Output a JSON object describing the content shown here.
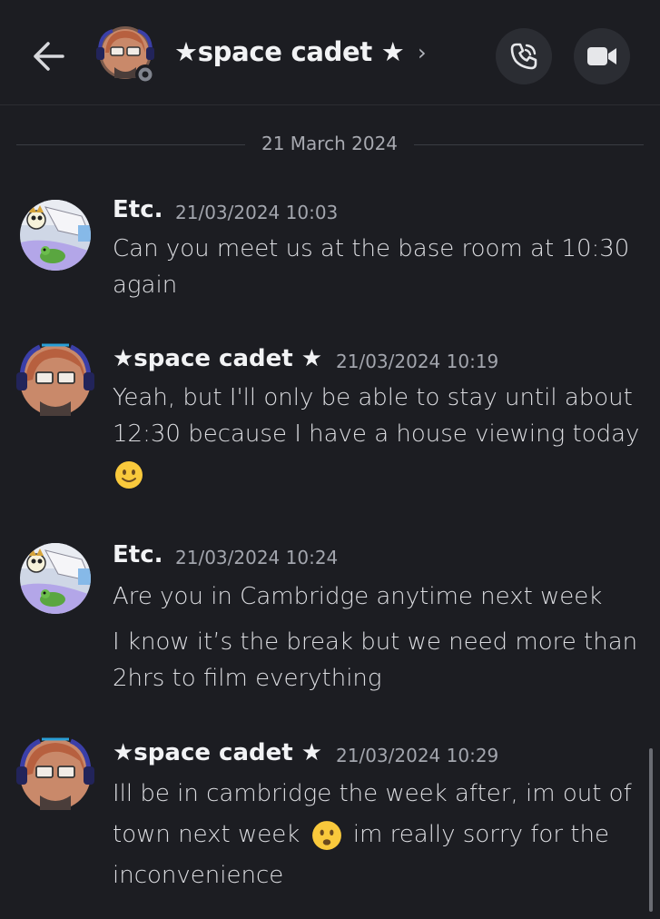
{
  "header": {
    "title": "★space cadet ★",
    "chevron": "›",
    "icons": {
      "back": "arrow-left-icon",
      "call": "phone-icon",
      "video": "video-camera-icon"
    }
  },
  "date_divider": "21 March 2024",
  "messages": [
    {
      "author": "Etc.",
      "time": "21/03/2024 10:03",
      "lines": [
        "Can you meet us at the base room at 10:30 again"
      ]
    },
    {
      "author": "★space cadet ★",
      "time": "21/03/2024 10:19",
      "lines": [
        "Yeah, but  I'll only be able to stay until about 12:30 because I have a house viewing today"
      ],
      "emoji": "slightly-smiling-face"
    },
    {
      "author": "Etc.",
      "time": "21/03/2024 10:24",
      "lines": [
        "Are you in Cambridge anytime next week",
        "I know it’s the break but we need more than 2hrs to film everything"
      ]
    },
    {
      "author": "★space cadet ★",
      "time": "21/03/2024 10:29",
      "line_a": "Ill be in cambridge the week after, im out of town next week",
      "line_b": "im really sorry for the inconvenience",
      "emoji": "frowning-face"
    }
  ],
  "colors": {
    "background": "#1c1d22",
    "button_bg": "#2b2d33",
    "text_primary": "#f2f3f5",
    "text_muted": "#a3a6ae"
  }
}
